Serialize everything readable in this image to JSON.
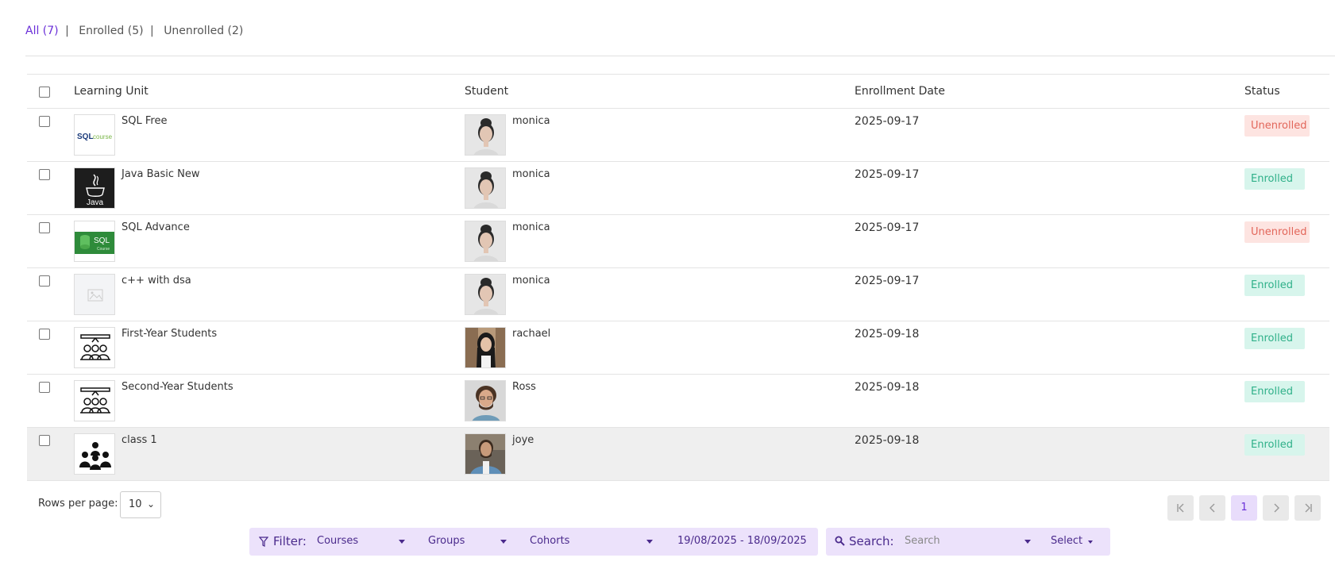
{
  "tabs": {
    "all": "All (7)",
    "enrolled": "Enrolled (5)",
    "unenrolled": "Unenrolled (2)",
    "separator": "|"
  },
  "table": {
    "headers": {
      "learning_unit": "Learning Unit",
      "student": "Student",
      "enrollment_date": "Enrollment Date",
      "status": "Status"
    },
    "rows": [
      {
        "unit": "SQL Free",
        "unit_icon": "sql-course-logo",
        "student": "monica",
        "avatar": "woman-portrait",
        "date": "2025-09-17",
        "status": "Unenrolled"
      },
      {
        "unit": "Java Basic New",
        "unit_icon": "java-logo",
        "student": "monica",
        "avatar": "woman-portrait",
        "date": "2025-09-17",
        "status": "Enrolled"
      },
      {
        "unit": "SQL Advance",
        "unit_icon": "sql-green-logo",
        "student": "monica",
        "avatar": "woman-portrait",
        "date": "2025-09-17",
        "status": "Unenrolled"
      },
      {
        "unit": "c++ with dsa",
        "unit_icon": "image-placeholder",
        "student": "monica",
        "avatar": "woman-portrait",
        "date": "2025-09-17",
        "status": "Enrolled"
      },
      {
        "unit": "First-Year Students",
        "unit_icon": "group-icon",
        "student": "rachael",
        "avatar": "woman-dark-hair-portrait",
        "date": "2025-09-18",
        "status": "Enrolled"
      },
      {
        "unit": "Second-Year Students",
        "unit_icon": "group-icon",
        "student": "Ross",
        "avatar": "man-curly-hair-portrait",
        "date": "2025-09-18",
        "status": "Enrolled"
      },
      {
        "unit": "class 1",
        "unit_icon": "class-people-icon",
        "student": "joye",
        "avatar": "man-beard-portrait",
        "date": "2025-09-18",
        "status": "Enrolled"
      }
    ]
  },
  "pagination": {
    "rows_per_page_label": "Rows per page:",
    "rows_per_page_value": "10",
    "current_page": "1",
    "first_icon": "K<",
    "prev_icon": "<",
    "next_icon": ">",
    "last_icon": ">I"
  },
  "filter": {
    "label": "Filter:",
    "courses": "Courses",
    "groups": "Groups",
    "cohorts": "Cohorts",
    "date_range": "19/08/2025 - 18/09/2025"
  },
  "search": {
    "label": "Search:",
    "placeholder": "Search",
    "select": "Select"
  },
  "colors": {
    "accent": "#6a2fd8",
    "enrolled_bg": "#d7f5ec",
    "enrolled_text": "#2fb089",
    "unenrolled_bg": "#fde4e1",
    "unenrolled_text": "#e2665a",
    "toolbar_bg": "#ece2fb"
  }
}
